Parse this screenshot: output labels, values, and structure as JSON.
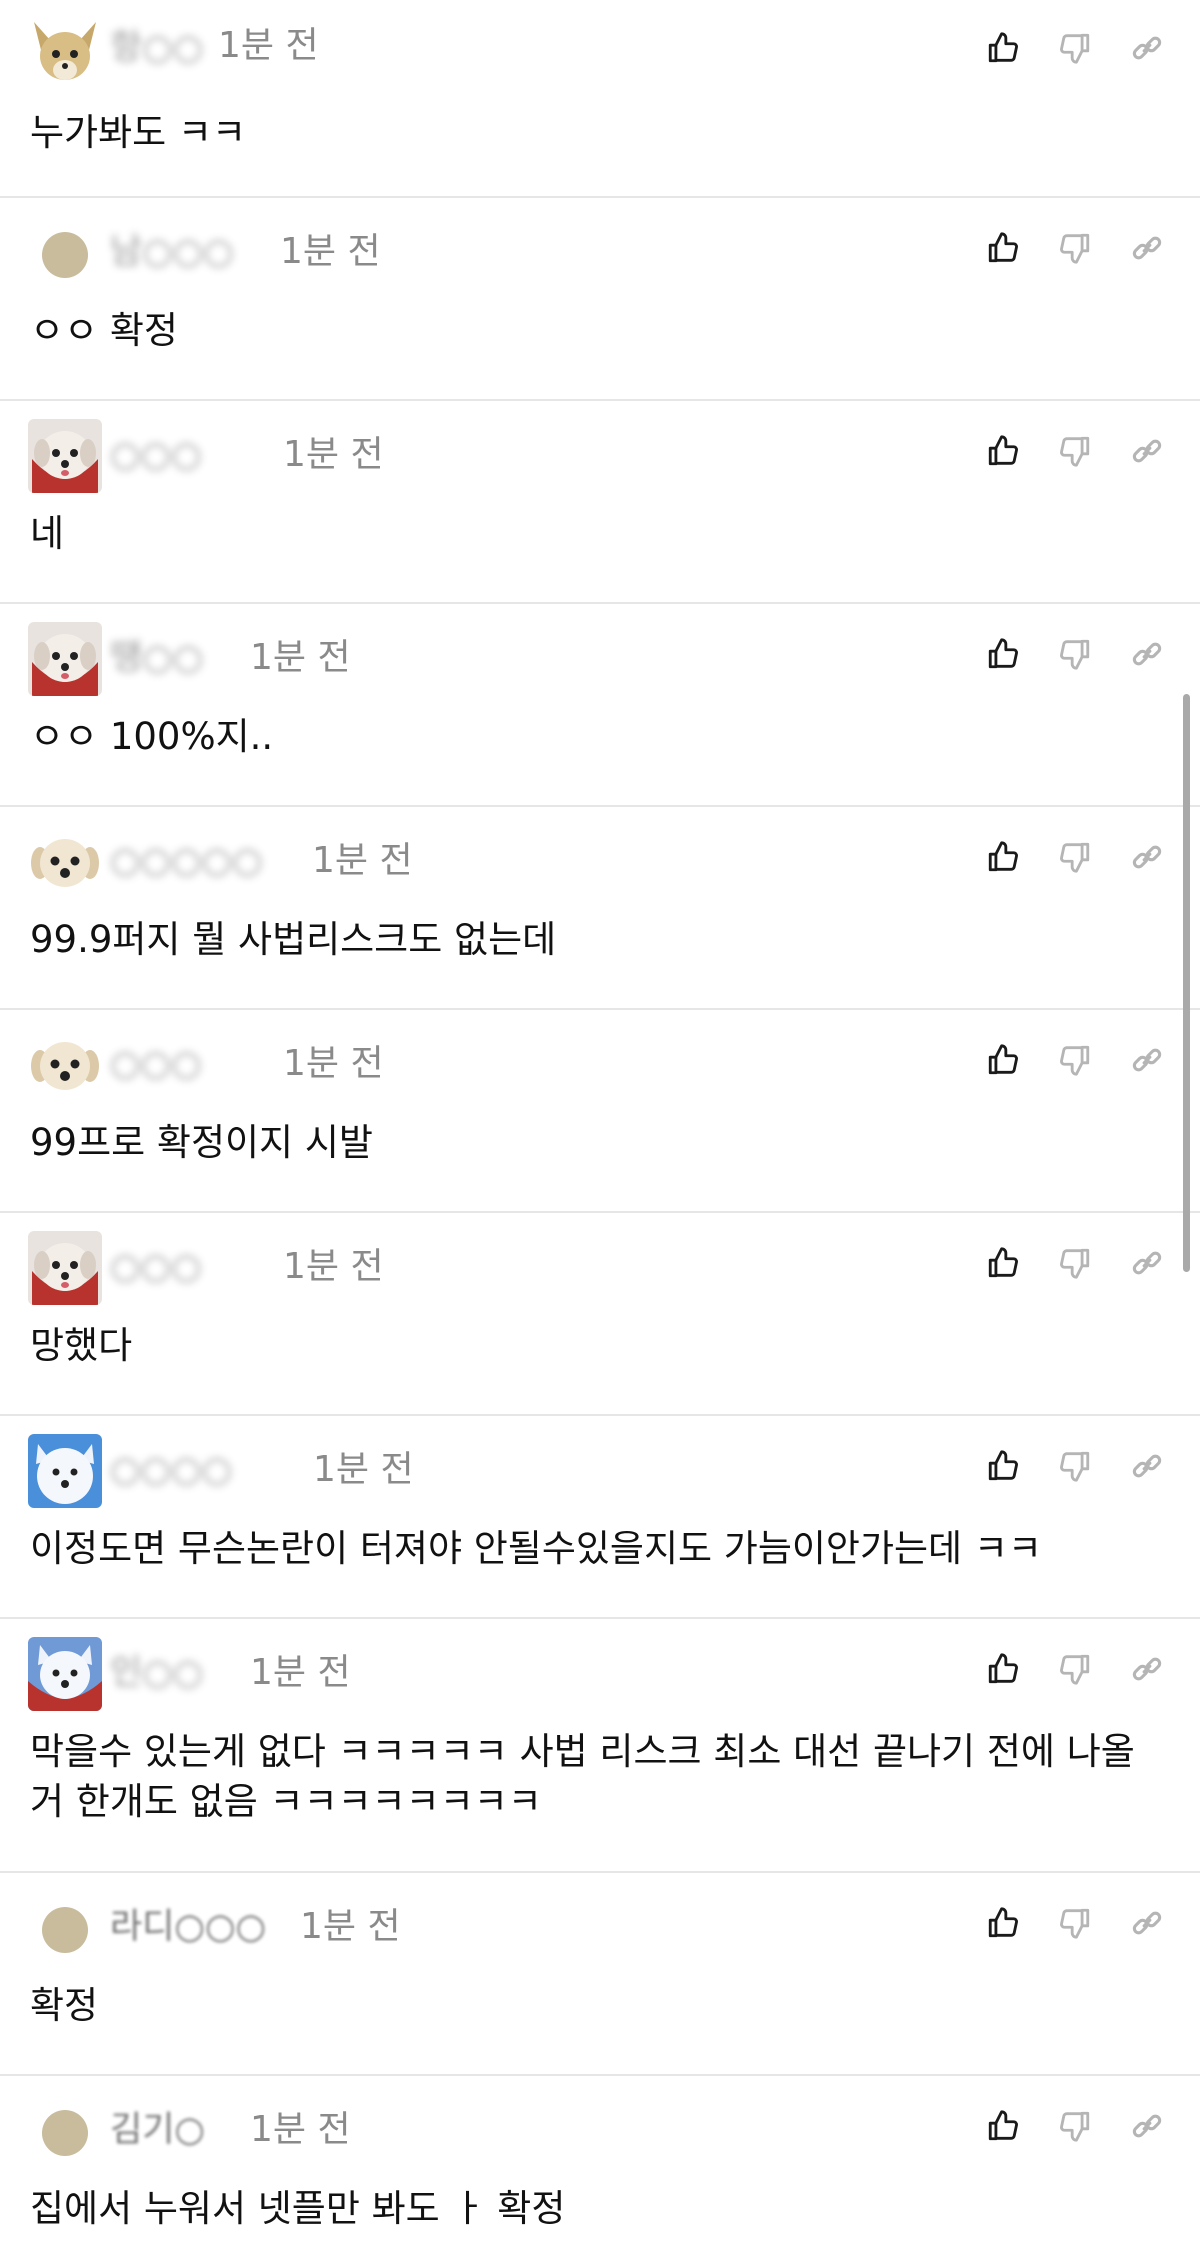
{
  "comments": [
    {
      "nick": "항○○",
      "time": "1분 전",
      "text": "누가봐도 ㅋㅋ",
      "avatar": "chihuahua-avatar"
    },
    {
      "nick": "남○○○",
      "time": "1분 전",
      "text": "ㅇㅇ 확정",
      "avatar": "default-avatar"
    },
    {
      "nick": "○○○",
      "time": "1분 전",
      "text": "네",
      "avatar": "puppy-avatar"
    },
    {
      "nick": "땡○○",
      "time": "1분 전",
      "text": "ㅇㅇ 100%지..",
      "avatar": "puppy-avatar"
    },
    {
      "nick": "○○○○○",
      "time": "1분 전",
      "text": "99.9퍼지 뭘 사법리스크도 없는데",
      "avatar": "white-puppy-avatar"
    },
    {
      "nick": "○○○",
      "time": "1분 전",
      "text": "99프로 확정이지 시발",
      "avatar": "white-puppy-avatar"
    },
    {
      "nick": "○○○",
      "time": "1분 전",
      "text": "망했다",
      "avatar": "puppy-avatar"
    },
    {
      "nick": "○○○○",
      "time": "1분 전",
      "text": "이정도면 무슨논란이 터져야 안될수있을지도 가늠이안가는데 ㅋㅋ",
      "avatar": "samoyed-avatar"
    },
    {
      "nick": "인○○",
      "time": "1분 전",
      "text": "막을수 있는게 없다 ㅋㅋㅋㅋㅋ 사법 리스크 최소 대선 끝나기 전에 나올 거 한개도 없음 ㅋㅋㅋㅋㅋㅋㅋㅋ",
      "avatar": "samoyed-red-avatar"
    },
    {
      "nick": "라디○○○",
      "time": "1분 전",
      "text": "확정",
      "avatar": "default-avatar"
    },
    {
      "nick": "김기○",
      "time": "1분 전",
      "text": "집에서 누워서 넷플만 봐도 ㅏ 확정",
      "avatar": "default-avatar"
    }
  ],
  "icons": {
    "like": "thumbs-up-icon",
    "dislike": "thumbs-down-icon",
    "link": "link-icon"
  },
  "colors": {
    "icon_dark": "#1a1a1a",
    "icon_light": "#b5b5b5",
    "divider": "#e6e6e6",
    "time": "#8a8a8a"
  }
}
